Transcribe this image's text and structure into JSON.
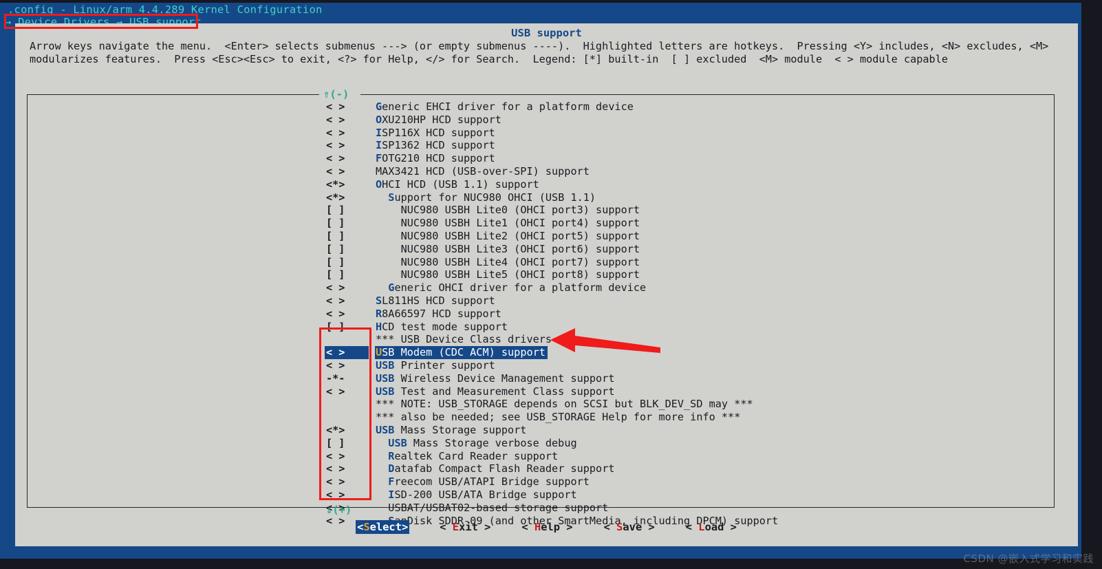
{
  "window": {
    "title": ".config - Linux/arm 4.4.289 Kernel Configuration",
    "breadcrumb": "→ Device Drivers → USB support",
    "dialog_title": "USB support"
  },
  "help": {
    "line1": "Arrow keys navigate the menu.  <Enter> selects submenus ---> (or empty submenus ----).  Highlighted letters are hotkeys.  Pressing <Y> includes, <N> excludes, <M>",
    "line2": "modularizes features.  Press <Esc><Esc> to exit, <?> for Help, </> for Search.  Legend: [*] built-in  [ ] excluded  <M> module  < > module capable"
  },
  "scroll": {
    "up_marker": "⇑(-)",
    "down_marker": "⇓(+)"
  },
  "menu": {
    "rows": [
      {
        "tag": "< >",
        "indent": 0,
        "hot": "G",
        "rest": "eneric EHCI driver for a platform device",
        "selected": false
      },
      {
        "tag": "< >",
        "indent": 0,
        "hot": "O",
        "rest": "XU210HP HCD support",
        "selected": false
      },
      {
        "tag": "< >",
        "indent": 0,
        "hot": "I",
        "rest": "SP116X HCD support",
        "selected": false
      },
      {
        "tag": "< >",
        "indent": 0,
        "hot": "I",
        "rest": "SP1362 HCD support",
        "selected": false
      },
      {
        "tag": "< >",
        "indent": 0,
        "hot": "F",
        "rest": "OTG210 HCD support",
        "selected": false
      },
      {
        "tag": "< >",
        "indent": 0,
        "hot": "",
        "rest": "MAX3421 HCD (USB-over-SPI) support",
        "selected": false
      },
      {
        "tag": "<*>",
        "indent": 0,
        "hot": "O",
        "rest": "HCI HCD (USB 1.1) support",
        "selected": false
      },
      {
        "tag": "<*>",
        "indent": 1,
        "hot": "S",
        "rest": "upport for NUC980 OHCI (USB 1.1)",
        "selected": false
      },
      {
        "tag": "[ ]",
        "indent": 2,
        "hot": "",
        "rest": "NUC980 USBH Lite0 (OHCI port3) support",
        "selected": false
      },
      {
        "tag": "[ ]",
        "indent": 2,
        "hot": "",
        "rest": "NUC980 USBH Lite1 (OHCI port4) support",
        "selected": false
      },
      {
        "tag": "[ ]",
        "indent": 2,
        "hot": "",
        "rest": "NUC980 USBH Lite2 (OHCI port5) support",
        "selected": false
      },
      {
        "tag": "[ ]",
        "indent": 2,
        "hot": "",
        "rest": "NUC980 USBH Lite3 (OHCI port6) support",
        "selected": false
      },
      {
        "tag": "[ ]",
        "indent": 2,
        "hot": "",
        "rest": "NUC980 USBH Lite4 (OHCI port7) support",
        "selected": false
      },
      {
        "tag": "[ ]",
        "indent": 2,
        "hot": "",
        "rest": "NUC980 USBH Lite5 (OHCI port8) support",
        "selected": false
      },
      {
        "tag": "< >",
        "indent": 1,
        "hot": "G",
        "rest": "eneric OHCI driver for a platform device",
        "selected": false
      },
      {
        "tag": "< >",
        "indent": 0,
        "hot": "S",
        "rest": "L811HS HCD support",
        "selected": false
      },
      {
        "tag": "< >",
        "indent": 0,
        "hot": "R",
        "rest": "8A66597 HCD support",
        "selected": false
      },
      {
        "tag": "[ ]",
        "indent": 0,
        "hot": "H",
        "rest": "CD test mode support",
        "selected": false
      },
      {
        "tag": "",
        "indent": 0,
        "hot": "",
        "rest": "*** USB Device Class drivers ***",
        "selected": false
      },
      {
        "tag": "< >",
        "indent": 0,
        "hot": "U",
        "rest": "SB Modem (CDC ACM) support",
        "selected": true
      },
      {
        "tag": "< >",
        "indent": 0,
        "hot": "USB",
        "rest": " Printer support",
        "selected": false
      },
      {
        "tag": "-*-",
        "indent": 0,
        "hot": "USB",
        "rest": " Wireless Device Management support",
        "selected": false
      },
      {
        "tag": "< >",
        "indent": 0,
        "hot": "USB",
        "rest": " Test and Measurement Class support",
        "selected": false
      },
      {
        "tag": "",
        "indent": 0,
        "hot": "",
        "rest": "*** NOTE: USB_STORAGE depends on SCSI but BLK_DEV_SD may ***",
        "selected": false
      },
      {
        "tag": "",
        "indent": 0,
        "hot": "",
        "rest": "*** also be needed; see USB_STORAGE Help for more info ***",
        "selected": false
      },
      {
        "tag": "<*>",
        "indent": 0,
        "hot": "USB",
        "rest": " Mass Storage support",
        "selected": false
      },
      {
        "tag": "[ ]",
        "indent": 1,
        "hot": "USB",
        "rest": " Mass Storage verbose debug",
        "selected": false
      },
      {
        "tag": "< >",
        "indent": 1,
        "hot": "R",
        "rest": "ealtek Card Reader support",
        "selected": false
      },
      {
        "tag": "< >",
        "indent": 1,
        "hot": "D",
        "rest": "atafab Compact Flash Reader support",
        "selected": false
      },
      {
        "tag": "< >",
        "indent": 1,
        "hot": "F",
        "rest": "reecom USB/ATAPI Bridge support",
        "selected": false
      },
      {
        "tag": "< >",
        "indent": 1,
        "hot": "I",
        "rest": "SD-200 USB/ATA Bridge support",
        "selected": false
      },
      {
        "tag": "< >",
        "indent": 1,
        "hot": "",
        "rest": "USBAT/USBAT02-based storage support",
        "selected": false
      },
      {
        "tag": "< >",
        "indent": 1,
        "hot": "S",
        "rest": "anDisk SDDR-09 (and other SmartMedia, including DPCM) support",
        "selected": false
      }
    ]
  },
  "buttons": [
    {
      "name": "select",
      "prefix": "<",
      "hot": "S",
      "rest": "elect>",
      "active": true
    },
    {
      "name": "exit",
      "prefix": "< ",
      "hot": "E",
      "rest": "xit >",
      "active": false
    },
    {
      "name": "help",
      "prefix": "< ",
      "hot": "H",
      "rest": "elp >",
      "active": false
    },
    {
      "name": "save",
      "prefix": "< ",
      "hot": "S",
      "rest": "ave >",
      "active": false
    },
    {
      "name": "load",
      "prefix": "< ",
      "hot": "L",
      "rest": "oad >",
      "active": false
    }
  ],
  "watermark": "CSDN @嵌入式学习和实践"
}
